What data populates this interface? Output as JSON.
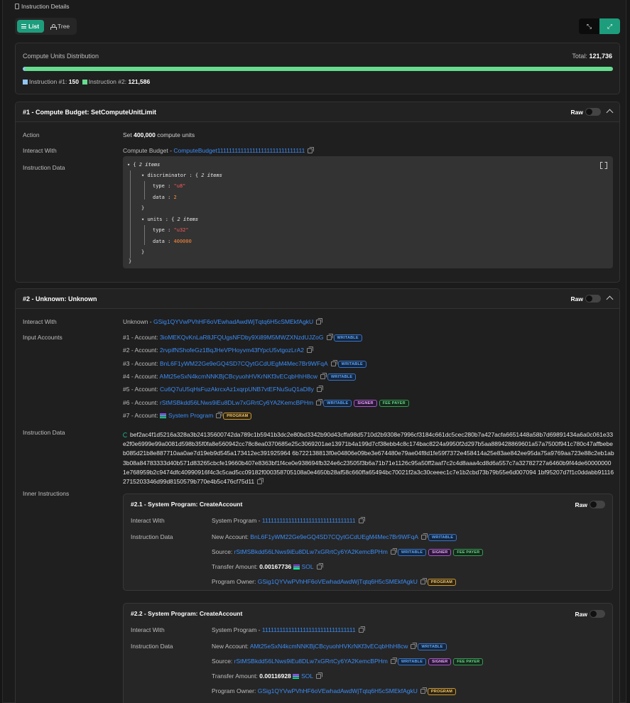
{
  "header": {
    "title": "Instruction Details"
  },
  "view_toggle": {
    "list": "List",
    "tree": "Tree"
  },
  "cu": {
    "title": "Compute Units Distribution",
    "total_label": "Total:",
    "total_value": "121,736",
    "ix1_label": "Instruction #1:",
    "ix1_value": "150",
    "ix1_fraction": 0.0012,
    "ix2_label": "Instruction #2:",
    "ix2_value": "121,586",
    "ix2_fraction": 0.9988,
    "colors": {
      "ix1": "#8fc6f5",
      "ix2": "#66dc8e"
    }
  },
  "ix1": {
    "title": "#1 - Compute Budget: SetComputeUnitLimit",
    "raw": "Raw",
    "action_label": "Action",
    "action_prefix": "Set",
    "action_value": "400,000",
    "action_suffix": "compute units",
    "interact_label": "Interact With",
    "interact_name": "Compute Budget -",
    "interact_address": "ComputeBudget111111111111111111111111111111",
    "data_label": "Instruction Data",
    "json": {
      "root_count": "2 items",
      "discriminator_key": "discriminator",
      "discriminator_count": "2 items",
      "disc_type_key": "type",
      "disc_type_val": "\"u8\"",
      "disc_data_key": "data",
      "disc_data_val": "2",
      "units_key": "units",
      "units_count": "2 items",
      "units_type_key": "type",
      "units_type_val": "\"u32\"",
      "units_data_key": "data",
      "units_data_val": "400000"
    }
  },
  "ix2": {
    "title": "#2 - Unknown: Unknown",
    "raw": "Raw",
    "interact_label": "Interact With",
    "interact_name": "Unknown -",
    "interact_address": "GSig1QYVwPVhHF6oVEwhadAwdWjTqtq6H5cSMEkfAgkU",
    "accounts_label": "Input Accounts",
    "accounts": [
      {
        "prefix": "#1 - Account:",
        "address": "3ioMEKQvKnLaR8JFQUgsNFDby9Xi89M5MWZXNzdUJZoG",
        "badges": [
          "WRITABLE"
        ]
      },
      {
        "prefix": "#2 - Account:",
        "address": "2rvpifNShofeGz1BqJHeVPHoyvm43fYpcU5vtgozLrA2",
        "badges": []
      },
      {
        "prefix": "#3 - Account:",
        "address": "BnL6F1yWM22Ge9eGQ4SD7CQytGCdUEgM4Mec7Br9WFqA",
        "badges": [
          "WRITABLE"
        ]
      },
      {
        "prefix": "#4 - Account:",
        "address": "AMt25eSxN4kcmNNKBjCBcyuohHVKrNKf3vECqbHhH8cw",
        "badges": [
          "WRITABLE"
        ]
      },
      {
        "prefix": "#5 - Account:",
        "address": "Cu6Q7uU5qHsFuzAkrcxAz1xqrpUNB7vtEFNuSuQ1aD8y",
        "badges": []
      },
      {
        "prefix": "#6 - Account:",
        "address": "rStMSBkdd56LNws9iEu8DLw7xGRrtCy6YA2KemcBPHm",
        "badges": [
          "WRITABLE",
          "SIGNER",
          "FEE PAYER"
        ]
      },
      {
        "prefix": "#7 - Account:",
        "address": "System Program",
        "badges": [
          "PROGRAM"
        ],
        "sol": true
      }
    ],
    "data_label": "Instruction Data",
    "data_hex": "bef2ac4f1d5216a328a3b24135600742da789c1b5941b3dc2e80bd3342b90d43cffa98d5710d2b9308e7996cf3184c661dc5cec280b7a427acfa6651448a58b7d69891434a6a0c061e33e2f0e6999e99a0081d598b35f0fa8e560942cc78c8ea0370685e25c3069201ae13971b4a199d7cf38ebb4c8c174bac8224a9950f2d297b5aa889428869601a57a7500f941c780c47affbebeb085d21b8e887710aa0ae7d19eb9d545a173412ec391925964 6b722138813f0e04806e09be3e674480e79ae04f8d1fe59f7372e458414a25e83ae842ee95da75a9769aa723e88c2eb1ab3b08a84783333d40b571d83265cbcfe19660b407e8363bf1f4ce0e938694fb324e6c23505f3b6a71b71e1126c95a50ff2aaf7c2c4d8aaa4cd8d6a557c7a32782727a6460b9f44de600000001e768959b2c9474dfc40990916f4c3c5cad5cc09182f000358705108a0e4650b28af58c660ffa65494bc70021f2a3c30ceeec1c7e1b2cbd73b79b55e6d007094 1bf95207d7f1c0ddabb911162715203346d99d8150579b770e4b5c476cf75d11",
    "inner_label": "Inner Instructions",
    "inner": [
      {
        "title": "#2.1 - System Program: CreateAccount",
        "raw": "Raw",
        "interact_label": "Interact With",
        "interact_name": "System Program -",
        "interact_address": "11111111111111111111111111111111",
        "data_label": "Instruction Data",
        "new_account_label": "New Account:",
        "new_account": "BnL6F1yWM22Ge9eGQ4SD7CQytGCdUEgM4Mec7Br9WFqA",
        "source_label": "Source:",
        "source": "rStMSBkdd56LNws9iEu8DLw7xGRrtCy6YA2KemcBPHm",
        "amount_label": "Transfer Amount:",
        "amount": "0.00167736",
        "amount_unit": "SOL",
        "owner_label": "Program Owner:",
        "owner": "GSig1QYVwPVhHF6oVEwhadAwdWjTqtq6H5cSMEkfAgkU"
      },
      {
        "title": "#2.2 - System Program: CreateAccount",
        "raw": "Raw",
        "interact_label": "Interact With",
        "interact_name": "System Program -",
        "interact_address": "11111111111111111111111111111111",
        "data_label": "Instruction Data",
        "new_account_label": "New Account:",
        "new_account": "AMt25eSxN4kcmNNKBjCBcyuohHVKrNKf3vECqbHhH8cw",
        "source_label": "Source:",
        "source": "rStMSBkdd56LNws9iEu8DLw7xGRrtCy6YA2KemcBPHm",
        "amount_label": "Transfer Amount:",
        "amount": "0.00116928",
        "amount_unit": "SOL",
        "owner_label": "Program Owner:",
        "owner": "GSig1QYVwPVhHF6oVEwhadAwdWjTqtq6H5cSMEkfAgkU"
      }
    ]
  },
  "badges": {
    "writable": "WRITABLE",
    "signer": "SIGNER",
    "fee": "FEE PAYER",
    "program": "PROGRAM"
  }
}
